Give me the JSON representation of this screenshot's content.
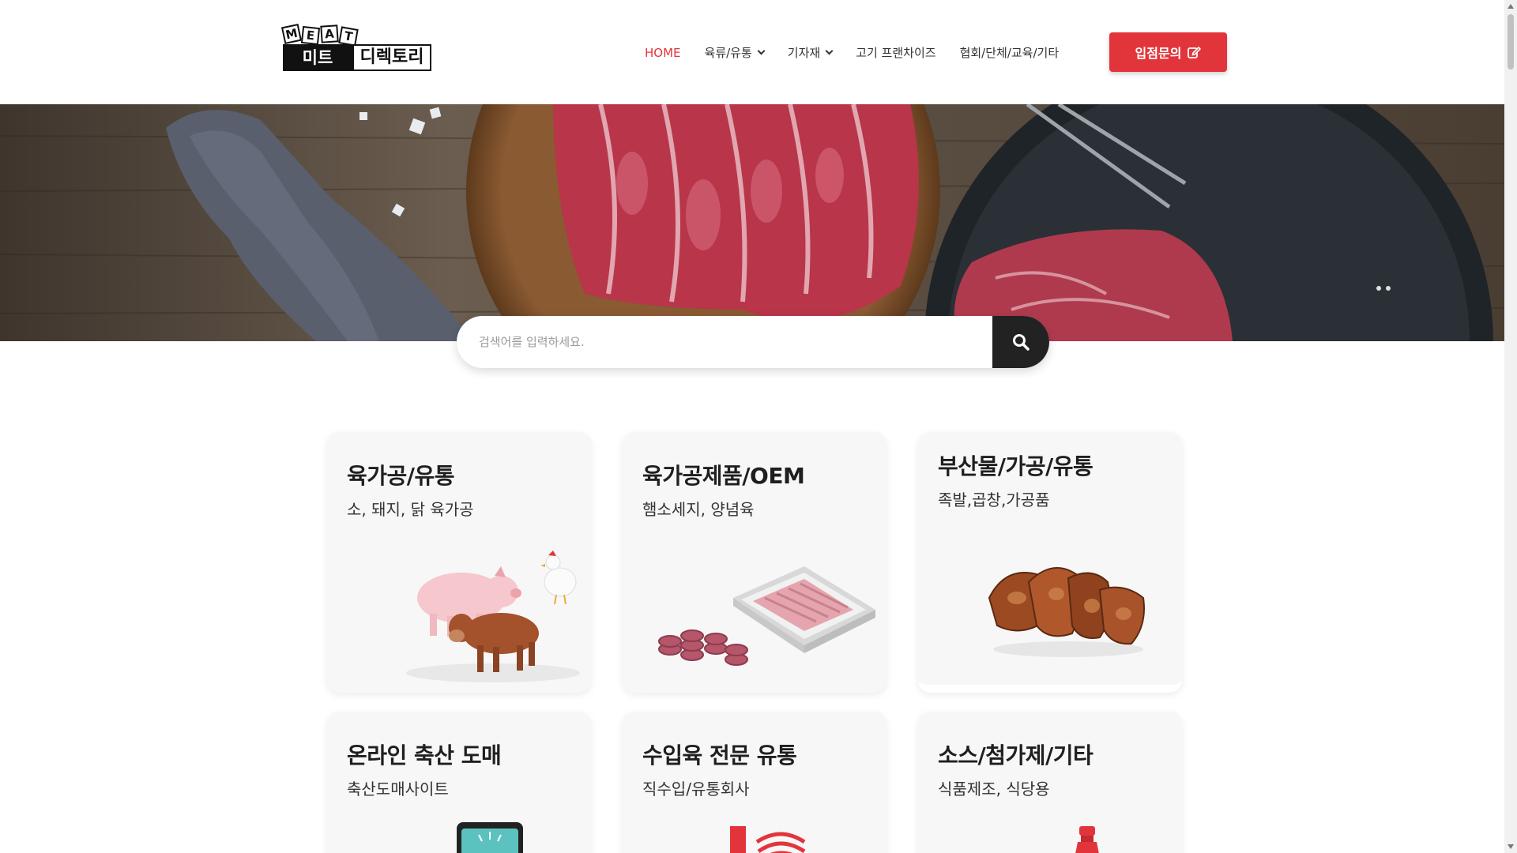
{
  "logo": {
    "letters": [
      "M",
      "E",
      "A",
      "T"
    ],
    "left_text": "미트",
    "right_text": "디렉토리"
  },
  "nav": {
    "items": [
      {
        "label": "HOME",
        "active": true,
        "dropdown": false
      },
      {
        "label": "육류/유통",
        "active": false,
        "dropdown": true
      },
      {
        "label": "기자재",
        "active": false,
        "dropdown": true
      },
      {
        "label": "고기 프랜차이즈",
        "active": false,
        "dropdown": false
      },
      {
        "label": "협회/단체/교육/기타",
        "active": false,
        "dropdown": false
      }
    ],
    "cta_label": "입점문의",
    "cta_icon": "edit-icon"
  },
  "search": {
    "placeholder": "검색어를 입력하세요.",
    "value": "",
    "icon": "search-icon"
  },
  "colors": {
    "accent": "#e2353b",
    "dark": "#222222",
    "card_bg": "#f7f7f7"
  },
  "cards": [
    {
      "title": "육가공/유통",
      "subtitle": "소, 돼지, 닭 육가공",
      "icon": "livestock-illustration"
    },
    {
      "title": "육가공제품/OEM",
      "subtitle": "햄소세지, 양념육",
      "icon": "sausage-ham-illustration"
    },
    {
      "title": "부산물/가공/유통",
      "subtitle": "족발,곱창,가공품",
      "icon": "pork-hock-illustration"
    },
    {
      "title": "온라인 축산 도매",
      "subtitle": "축산도매사이트",
      "icon": "tablet-illustration"
    },
    {
      "title": "수입육 전문 유통",
      "subtitle": "직수입/유통회사",
      "icon": "import-illustration"
    },
    {
      "title": "소스/첨가제/기타",
      "subtitle": "식품제조, 식당용",
      "icon": "sauce-bottle-illustration"
    }
  ]
}
